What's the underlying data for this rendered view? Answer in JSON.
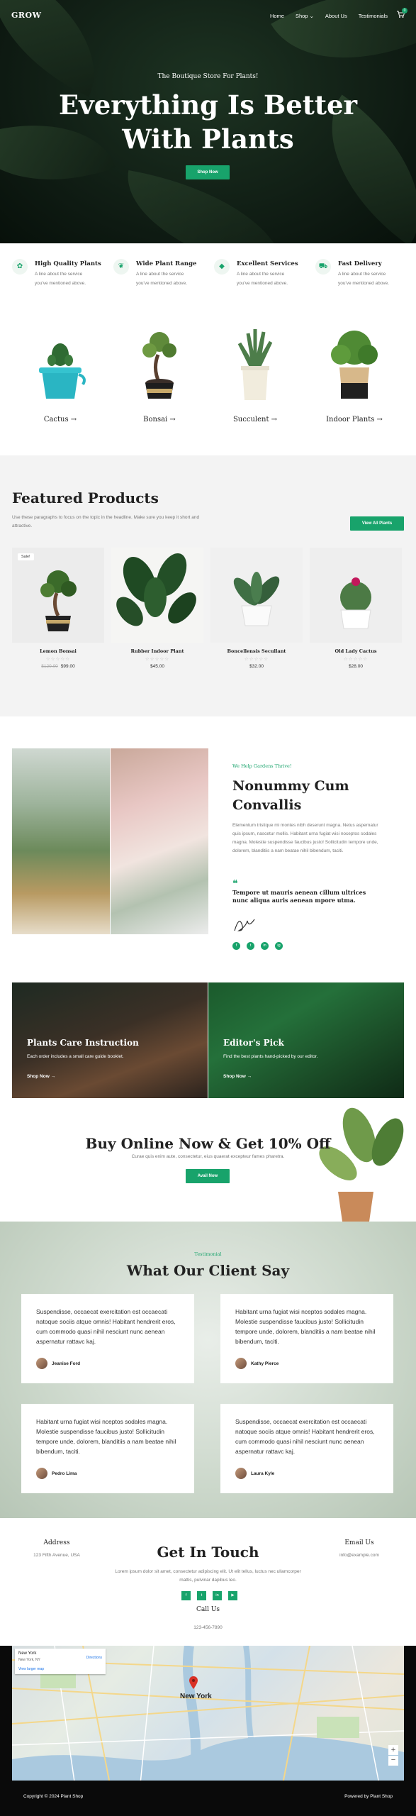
{
  "header": {
    "logo": "GROW",
    "nav": [
      "Home",
      "Shop",
      "About Us",
      "Testimonials"
    ],
    "shop_caret": "⌄",
    "cart_count": "0"
  },
  "hero": {
    "eyebrow": "The Boutique Store For Plants!",
    "title": "Everything Is Better With Plants",
    "cta": "Shop Now"
  },
  "features": [
    {
      "icon": "leaf-icon",
      "title": "High Quality Plants",
      "text": "A line about the service you've mentioned above."
    },
    {
      "icon": "sprout-icon",
      "title": "Wide Plant Range",
      "text": "A line about the service you've mentioned above."
    },
    {
      "icon": "gem-icon",
      "title": "Excellent Services",
      "text": "A line about the service you've mentioned above."
    },
    {
      "icon": "truck-icon",
      "title": "Fast Delivery",
      "text": "A line about the service you've mentioned above."
    }
  ],
  "categories": [
    "Cactus →",
    "Bonsai →",
    "Succulent →",
    "Indoor Plants →"
  ],
  "featured": {
    "title": "Featured Products",
    "description": "Use these paragraphs to focus on the topic in the headline. Make sure you keep it short and attractive.",
    "view_all": "View All Plants",
    "sale_badge": "Sale!",
    "stars": "☆☆☆☆☆",
    "products": [
      {
        "name": "Lemon Bonsai",
        "old_price": "$120.00",
        "price": "$99.00"
      },
      {
        "name": "Rubber Indoor Plant",
        "old_price": "",
        "price": "$45.00"
      },
      {
        "name": "Boncellensis Secullant",
        "old_price": "",
        "price": "$32.00"
      },
      {
        "name": "Old Lady Cactus",
        "old_price": "",
        "price": "$28.00"
      }
    ]
  },
  "about": {
    "eyebrow": "We Help Gardens Thrive!",
    "title": "Nonummy Cum Convallis",
    "text": "Elementum tristique mi montes nibh deserunt magna. Netus aspernatur quis ipsum, nascetur mollis. Habitant urna fugiat wisi noceptos sodales magna. Molestie suspendisse faucibus justo! Sollicitudin tempore unde, dolorem, blanditiis a nam beatae nihil bibendum, taciti.",
    "quote": "Tempore ut mauris aenean cillum ultrices nunc aliqua auris aenean mpore utma.",
    "socials": [
      "f",
      "t",
      "in",
      "ig"
    ]
  },
  "promos": [
    {
      "title": "Plants Care Instruction",
      "text": "Each order includes a small care guide booklet.",
      "link": "Shop Now →"
    },
    {
      "title": "Editor's Pick",
      "text": "Find the best plants hand-picked by our editor.",
      "link": "Shop Now →"
    }
  ],
  "buy_online": {
    "title": "Buy Online Now & Get 10% Off",
    "subtitle": "Curae quis enim aute, consectetur, eius quaerat excepteur fames pharetra.",
    "cta": "Avail Now"
  },
  "testimonials": {
    "eyebrow": "Testimonial",
    "title": "What Our Client Say",
    "items": [
      {
        "text": "Suspendisse, occaecat exercitation est occaecati natoque sociis atque omnis! Habitant hendrerit eros, cum commodo quasi nihil nesciunt nunc aenean aspernatur rattavc kaj.",
        "name": "Jeanise Ford"
      },
      {
        "text": "Habitant urna fugiat wisi nceptos sodales magna. Molestie suspendisse faucibus justo! Sollicitudin tempore unde, dolorem, blanditiis a nam beatae nihil bibendum, taciti.",
        "name": "Kathy Pierce"
      },
      {
        "text": "Habitant urna fugiat wisi nceptos sodales magna. Molestie suspendisse faucibus justo! Sollicitudin tempore unde, dolorem, blanditiis a nam beatae nihil bibendum, taciti.",
        "name": "Pedro Lima"
      },
      {
        "text": "Suspendisse, occaecat exercitation est occaecati natoque sociis atque omnis! Habitant hendrerit eros, cum commodo quasi nihil nesciunt nunc aenean aspernatur rattavc kaj.",
        "name": "Laura Kyle"
      }
    ]
  },
  "contact": {
    "address_title": "Address",
    "address": "123 Fifth Avenue, USA",
    "title": "Get In Touch",
    "text": "Lorem ipsum dolor sit amet, consectetur adipiscing elit. Ut elit tellus, luctus nec ullamcorper mattis, pulvinar dapibus leo.",
    "email_title": "Email Us",
    "email": "info@example.com",
    "socials": [
      "f",
      "t",
      "in",
      "▶"
    ],
    "call_title": "Call Us",
    "phone": "123-456-7890"
  },
  "map": {
    "city": "New York",
    "address": "New York, NY",
    "larger_link": "View larger map",
    "directions": "Directions",
    "label": "New York",
    "zoom_in": "+",
    "zoom_out": "−",
    "attribution": "Keyboard shortcuts  Map data ©2024 Google  Terms  Report a map error"
  },
  "footer": {
    "copyright": "Copyright © 2024 Plant Shop",
    "powered": "Powered by Plant Shop"
  }
}
